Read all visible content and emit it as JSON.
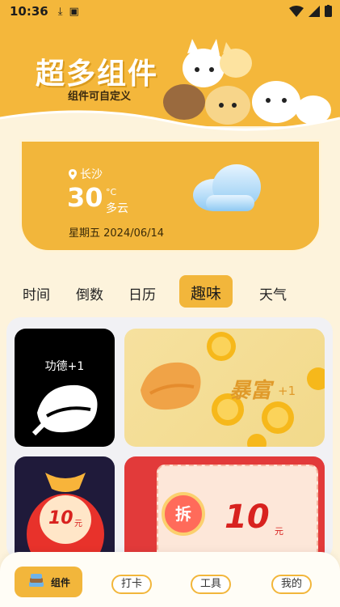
{
  "status_bar": {
    "time": "10:36"
  },
  "banner": {
    "title": "超多组件",
    "subtitle": "组件可自定义"
  },
  "weather": {
    "city": "长沙",
    "temperature": "30",
    "unit": "°C",
    "condition": "多云",
    "date": "星期五 2024/06/14"
  },
  "tabs": [
    {
      "label": "时间"
    },
    {
      "label": "倒数"
    },
    {
      "label": "日历"
    },
    {
      "label": "趣味"
    },
    {
      "label": "天气"
    }
  ],
  "widgets": {
    "merit": {
      "label": "功德+1"
    },
    "fortune": {
      "label": "暴富",
      "plus": "+1"
    },
    "lucky_bag": {
      "amount": "10",
      "unit": "元"
    },
    "red_packet": {
      "open": "拆",
      "amount": "10",
      "unit": "元"
    }
  },
  "bottom_nav": [
    {
      "label": "组件"
    },
    {
      "label": "打卡"
    },
    {
      "label": "工具"
    },
    {
      "label": "我的"
    }
  ]
}
